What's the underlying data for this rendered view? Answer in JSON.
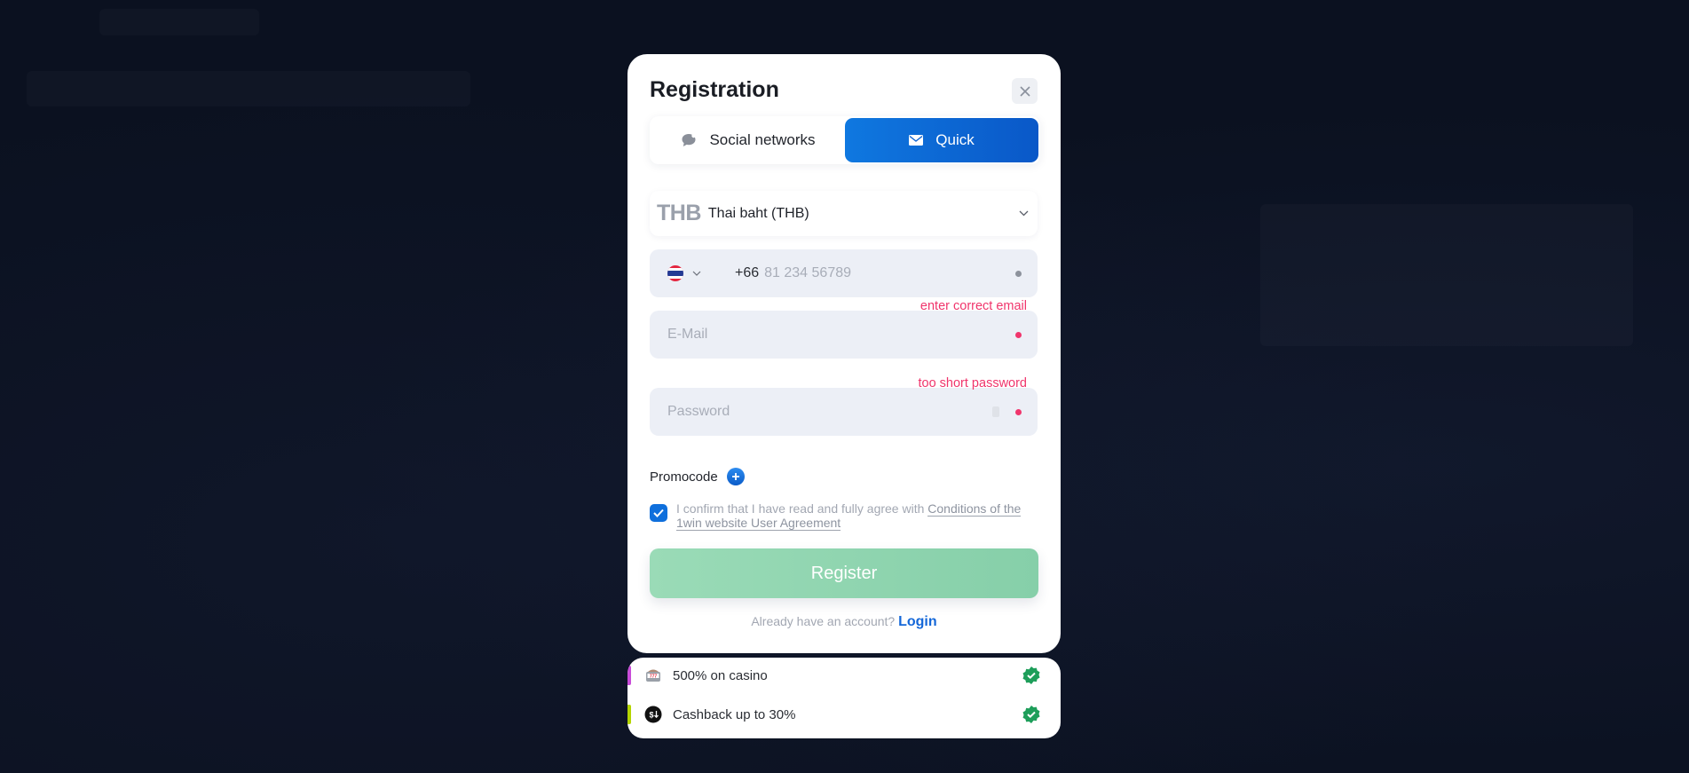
{
  "modal": {
    "title": "Registration",
    "close_label": "close",
    "tabs": [
      {
        "label": "Social networks",
        "icon": "chat-bubble-icon",
        "active": false
      },
      {
        "label": "Quick",
        "icon": "envelope-icon",
        "active": true
      }
    ],
    "currency": {
      "code": "THB",
      "name": "Thai baht (THB)"
    },
    "phone": {
      "country": "Thailand",
      "dial_code": "+66",
      "placeholder": "81 234 56789"
    },
    "email": {
      "placeholder": "E-Mail",
      "error": "enter correct email"
    },
    "password": {
      "placeholder": "Password",
      "error": "too short password"
    },
    "promocode_label": "Promocode",
    "agreement": {
      "checked": true,
      "text": "I confirm that I have read and fully agree with ",
      "link": "Conditions of the 1win website User Agreement"
    },
    "register_label": "Register",
    "login_prompt": "Already have an account?",
    "login_label": "Login"
  },
  "bonuses": [
    {
      "label": "500% on casino",
      "icon": "slot-machine-icon",
      "accent": "#c84bd8"
    },
    {
      "label": "Cashback up to 30%",
      "icon": "cashback-icon",
      "accent": "#b4d400"
    }
  ],
  "colors": {
    "primary": "#0f6fdc",
    "error": "#f0356c",
    "success": "#1e9e5a",
    "register_disabled": "#8fd5b0"
  }
}
